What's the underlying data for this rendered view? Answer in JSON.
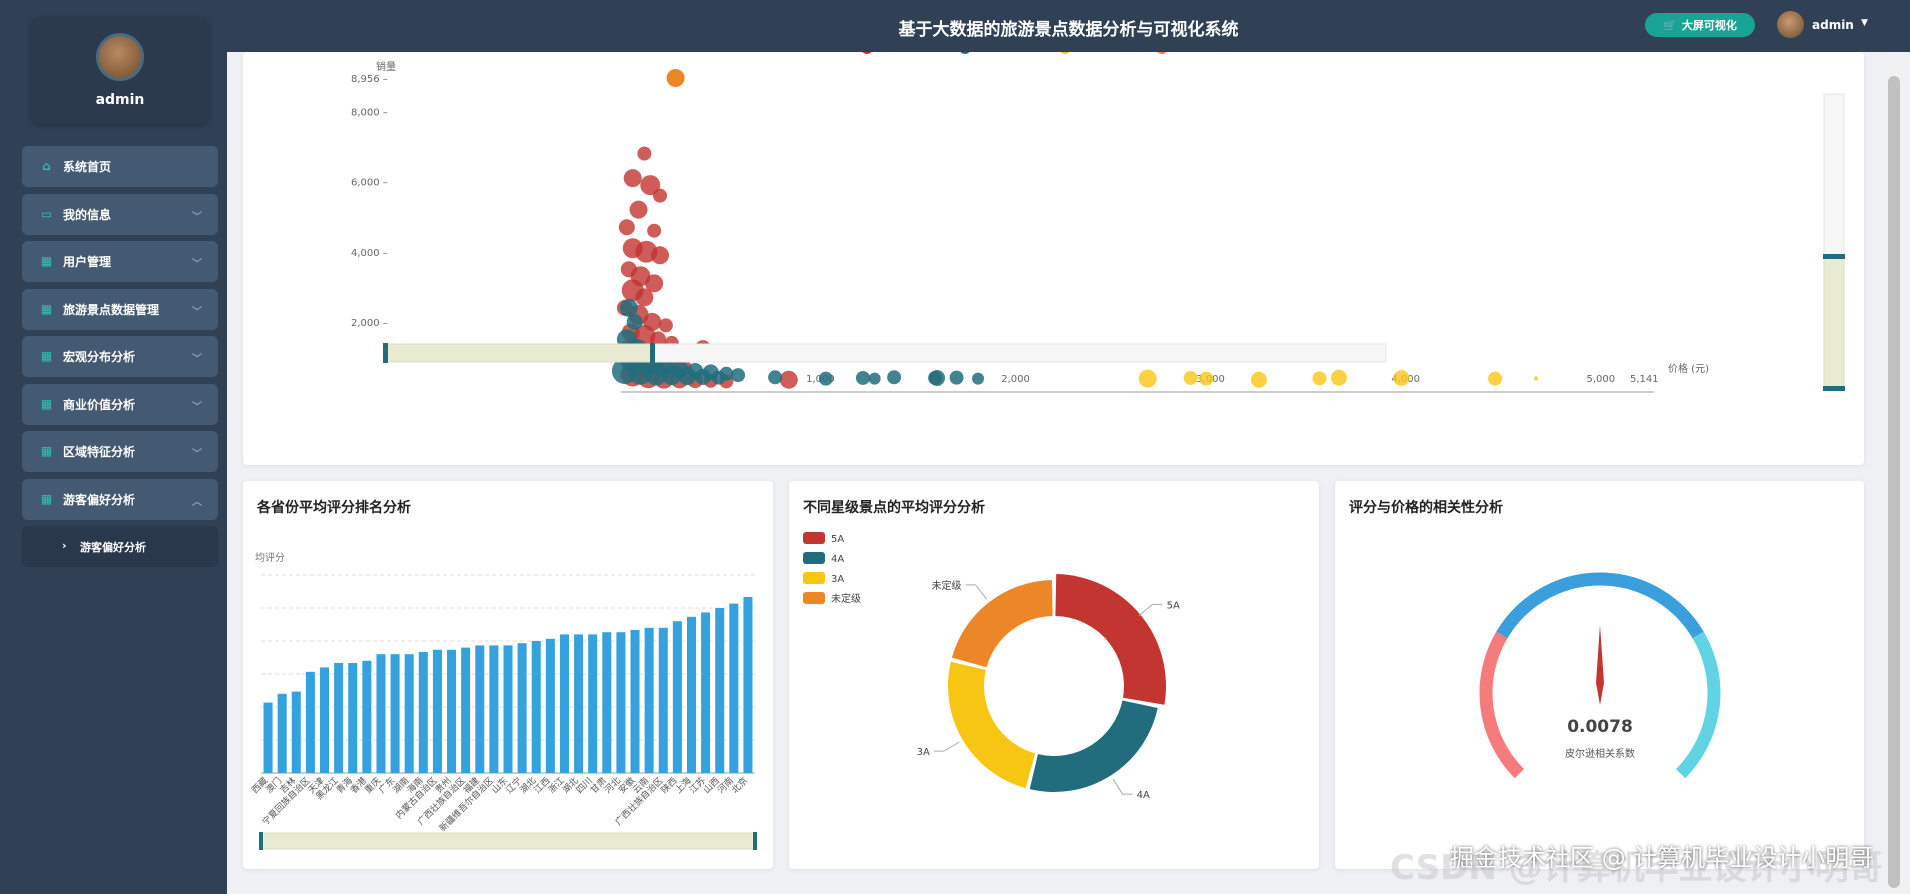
{
  "sidebar": {
    "username": "admin",
    "items": [
      {
        "label": "系统首页",
        "icon": "home-icon",
        "chevron": false
      },
      {
        "label": "我的信息",
        "icon": "monitor-icon",
        "chevron": true
      },
      {
        "label": "用户管理",
        "icon": "grid-icon",
        "chevron": true
      },
      {
        "label": "旅游景点数据管理",
        "icon": "grid-icon",
        "chevron": true
      },
      {
        "label": "宏观分布分析",
        "icon": "grid-icon",
        "chevron": true
      },
      {
        "label": "商业价值分析",
        "icon": "grid-icon",
        "chevron": true
      },
      {
        "label": "区域特征分析",
        "icon": "grid-icon",
        "chevron": true
      },
      {
        "label": "游客偏好分析",
        "icon": "grid-icon",
        "chevron": true,
        "expanded": true
      }
    ],
    "subitem": "游客偏好分析"
  },
  "header": {
    "title": "基于大数据的旅游景点数据分析与可视化系统",
    "big_screen_button": "大屏可视化",
    "user": "admin"
  },
  "watermark": "掘金技术社区 @ 计算机毕业设计小明哥",
  "watermark_back": "CSDN @计算机毕业设计小明哥",
  "colors": {
    "red": "#c23531",
    "teal": "#216d7e",
    "yellow": "#f7c613",
    "orange": "#ec8727",
    "blue_bar": "#36a2dd",
    "accent": "#19a394"
  },
  "chart_data": [
    {
      "type": "scatter",
      "title": "",
      "xlabel": "价格 (元)",
      "ylabel": "销量",
      "xlim": [
        0,
        5141
      ],
      "ylim": [
        0,
        8956
      ],
      "x_ticks": [
        "1,000",
        "2,000",
        "3,000",
        "4,000",
        "5,000",
        "5,141"
      ],
      "y_ticks": [
        "2,000",
        "4,000",
        "6,000",
        "8,000",
        "8,956"
      ],
      "series": [
        {
          "name": "",
          "color": "red",
          "points": [
            [
              280,
              8956,
              8
            ],
            [
              120,
              6800,
              7
            ],
            [
              60,
              6100,
              9
            ],
            [
              150,
              5900,
              10
            ],
            [
              200,
              5600,
              7
            ],
            [
              90,
              5200,
              9
            ],
            [
              30,
              4700,
              8
            ],
            [
              170,
              4600,
              7
            ],
            [
              60,
              4100,
              10
            ],
            [
              130,
              4000,
              11
            ],
            [
              200,
              3900,
              9
            ],
            [
              40,
              3500,
              8
            ],
            [
              100,
              3300,
              10
            ],
            [
              170,
              3100,
              9
            ],
            [
              60,
              2900,
              11
            ],
            [
              120,
              2700,
              9
            ],
            [
              20,
              2400,
              8
            ],
            [
              90,
              2200,
              10
            ],
            [
              160,
              2000,
              9
            ],
            [
              230,
              1900,
              7
            ],
            [
              50,
              1700,
              9
            ],
            [
              120,
              1600,
              11
            ],
            [
              190,
              1500,
              8
            ],
            [
              260,
              1400,
              7
            ],
            [
              420,
              1250,
              8
            ],
            [
              40,
              1200,
              10
            ],
            [
              100,
              1000,
              12
            ],
            [
              170,
              900,
              10
            ],
            [
              240,
              800,
              9
            ],
            [
              320,
              700,
              8
            ],
            [
              860,
              350,
              9
            ],
            [
              60,
              500,
              12
            ],
            [
              140,
              420,
              11
            ],
            [
              220,
              380,
              10
            ],
            [
              300,
              360,
              9
            ],
            [
              380,
              340,
              8
            ],
            [
              460,
              320,
              7
            ],
            [
              540,
              300,
              7
            ]
          ]
        },
        {
          "name": "",
          "color": "teal",
          "points": [
            [
              40,
              2400,
              9
            ],
            [
              70,
              2000,
              8
            ],
            [
              30,
              1500,
              10
            ],
            [
              80,
              1200,
              11
            ],
            [
              130,
              1100,
              10
            ],
            [
              60,
              900,
              12
            ],
            [
              150,
              800,
              11
            ],
            [
              220,
              700,
              10
            ],
            [
              300,
              650,
              9
            ],
            [
              380,
              600,
              8
            ],
            [
              460,
              560,
              8
            ],
            [
              540,
              520,
              7
            ],
            [
              600,
              480,
              7
            ],
            [
              790,
              420,
              7
            ],
            [
              1240,
              400,
              7
            ],
            [
              1300,
              380,
              6
            ],
            [
              1400,
              420,
              7
            ],
            [
              1610,
              400,
              7
            ],
            [
              1620,
              400,
              8
            ],
            [
              1720,
              410,
              7
            ],
            [
              1830,
              380,
              6
            ],
            [
              1050,
              380,
              7
            ],
            [
              20,
              600,
              13
            ],
            [
              100,
              550,
              12
            ],
            [
              180,
              500,
              11
            ],
            [
              260,
              480,
              10
            ],
            [
              340,
              450,
              9
            ],
            [
              420,
              430,
              8
            ],
            [
              500,
              410,
              7
            ]
          ]
        },
        {
          "name": "",
          "color": "yellow",
          "points": [
            [
              2700,
              380,
              9
            ],
            [
              2920,
              400,
              7
            ],
            [
              3000,
              380,
              7
            ],
            [
              3270,
              350,
              8
            ],
            [
              3580,
              390,
              7
            ],
            [
              3680,
              410,
              8
            ],
            [
              4000,
              400,
              8
            ],
            [
              4480,
              380,
              7
            ],
            [
              4690,
              390,
              2
            ]
          ]
        },
        {
          "name": "",
          "color": "orange",
          "points": [
            [
              280,
              8956,
              8
            ]
          ]
        }
      ]
    },
    {
      "type": "bar",
      "title": "各省份平均评分排名分析",
      "ylabel": "均评分",
      "categories": [
        "西藏",
        "澳门",
        "吉林",
        "宁夏回族自治区",
        "天津",
        "黑龙江",
        "青海",
        "香港",
        "重庆",
        "广东",
        "湖南",
        "海南",
        "内蒙古自治区",
        "贵州",
        "广西壮族自治区",
        "福建",
        "新疆维吾尔自治区",
        "山东",
        "辽宁",
        "湖北",
        "江西",
        "浙江",
        "湖北",
        "四川",
        "甘肃",
        "河北",
        "安徽",
        "云南",
        "广西壮族自治区",
        "陕西",
        "上海",
        "江苏",
        "山西",
        "河南",
        "北京"
      ],
      "values": [
        3.2,
        3.6,
        3.7,
        4.6,
        4.8,
        5.0,
        5.0,
        5.1,
        5.4,
        5.4,
        5.4,
        5.5,
        5.6,
        5.6,
        5.7,
        5.8,
        5.8,
        5.8,
        5.9,
        6.0,
        6.1,
        6.3,
        6.3,
        6.3,
        6.4,
        6.4,
        6.5,
        6.6,
        6.6,
        6.9,
        7.1,
        7.3,
        7.5,
        7.7,
        8.0
      ],
      "ylim": [
        0,
        9
      ]
    },
    {
      "type": "pie",
      "title": "不同星级景点的平均评分分析",
      "legend": [
        "5A",
        "4A",
        "3A",
        "未定级"
      ],
      "slices": [
        {
          "label": "5A",
          "value": 28,
          "color": "red"
        },
        {
          "label": "4A",
          "value": 26,
          "color": "teal"
        },
        {
          "label": "3A",
          "value": 25,
          "color": "yellow"
        },
        {
          "label": "未定级",
          "value": 21,
          "color": "orange"
        }
      ]
    },
    {
      "type": "gauge",
      "title": "评分与价格的相关性分析",
      "value": "0.0078",
      "label": "皮尔逊相关系数"
    }
  ]
}
